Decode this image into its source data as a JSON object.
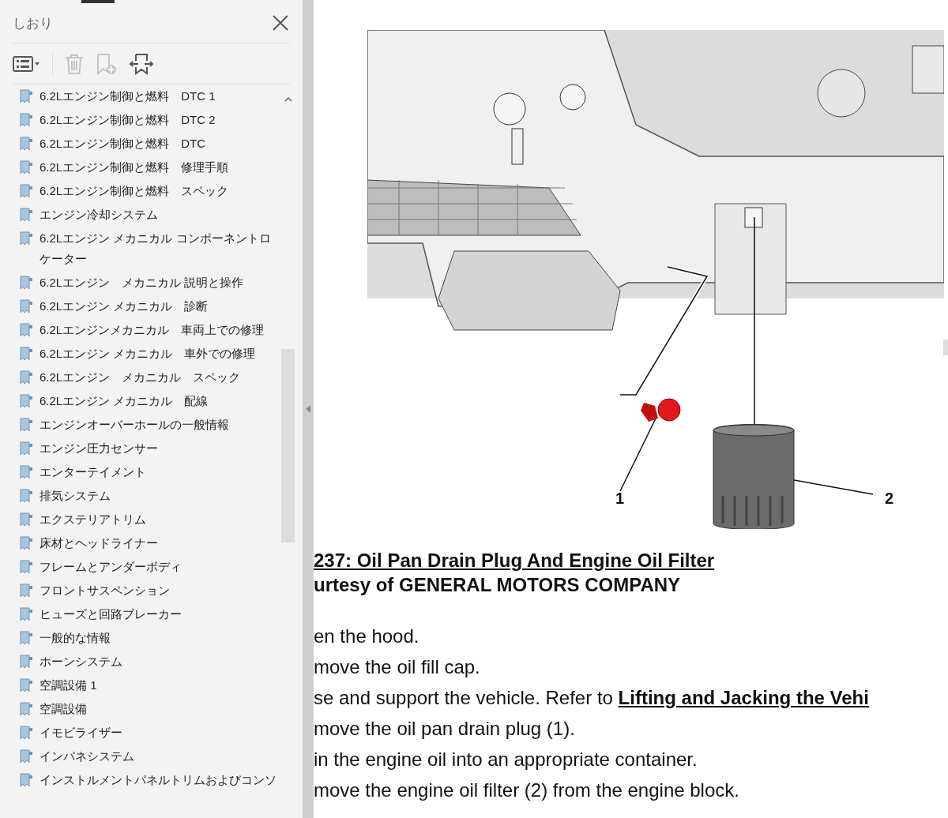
{
  "sidebar": {
    "title": "しおり",
    "toolbar": [
      {
        "kind": "options",
        "disabled": false
      },
      {
        "kind": "delete",
        "disabled": true
      },
      {
        "kind": "add",
        "disabled": true
      },
      {
        "kind": "expand",
        "disabled": false
      }
    ],
    "bookmarks": [
      {
        "label": "6.2Lエンジン制御と燃料　DTC 1"
      },
      {
        "label": "6.2Lエンジン制御と燃料　DTC 2"
      },
      {
        "label": "6.2Lエンジン制御と燃料　DTC"
      },
      {
        "label": "6.2Lエンジン制御と燃料　修理手順"
      },
      {
        "label": "6.2Lエンジン制御と燃料　スペック"
      },
      {
        "label": "エンジン冷却システム"
      },
      {
        "label": "6.2Lエンジン メカニカル コンポーネントロケーター"
      },
      {
        "label": "6.2Lエンジン　メカニカル 説明と操作"
      },
      {
        "label": "6.2Lエンジン メカニカル　診断"
      },
      {
        "label": "6.2Lエンジンメカニカル　車両上での修理"
      },
      {
        "label": "6.2Lエンジン メカニカル　車外での修理"
      },
      {
        "label": "6.2Lエンジン　メカニカル　スペック"
      },
      {
        "label": "6.2Lエンジン メカニカル　配線"
      },
      {
        "label": "エンジンオーバーホールの一般情報"
      },
      {
        "label": "エンジン圧力センサー"
      },
      {
        "label": "エンターテイメント"
      },
      {
        "label": "排気システム"
      },
      {
        "label": "エクステリアトリム"
      },
      {
        "label": "床材とヘッドライナー"
      },
      {
        "label": "フレームとアンダーボディ"
      },
      {
        "label": "フロントサスペンション"
      },
      {
        "label": "ヒューズと回路ブレーカー"
      },
      {
        "label": "一般的な情報"
      },
      {
        "label": "ホーンシステム"
      },
      {
        "label": "空調設備 1"
      },
      {
        "label": "空調設備"
      },
      {
        "label": "イモビライザー"
      },
      {
        "label": "インパネシステム"
      },
      {
        "label": "インストルメントパネルトリムおよびコンソ"
      }
    ]
  },
  "document": {
    "figure": {
      "callouts": [
        "1",
        "2"
      ]
    },
    "caption": [
      "237: Oil Pan Drain Plug And Engine Oil Filter",
      "urtesy of GENERAL MOTORS COMPANY"
    ],
    "steps": [
      {
        "text": "en the hood."
      },
      {
        "text": "move the oil fill cap."
      },
      {
        "text": "se and support the vehicle. Refer to ",
        "link": "Lifting and Jacking the Vehi"
      },
      {
        "text": "move the oil pan drain plug (1)."
      },
      {
        "text": "in the engine oil into an appropriate container."
      },
      {
        "text": "move the engine oil filter (2) from the engine block."
      }
    ]
  }
}
